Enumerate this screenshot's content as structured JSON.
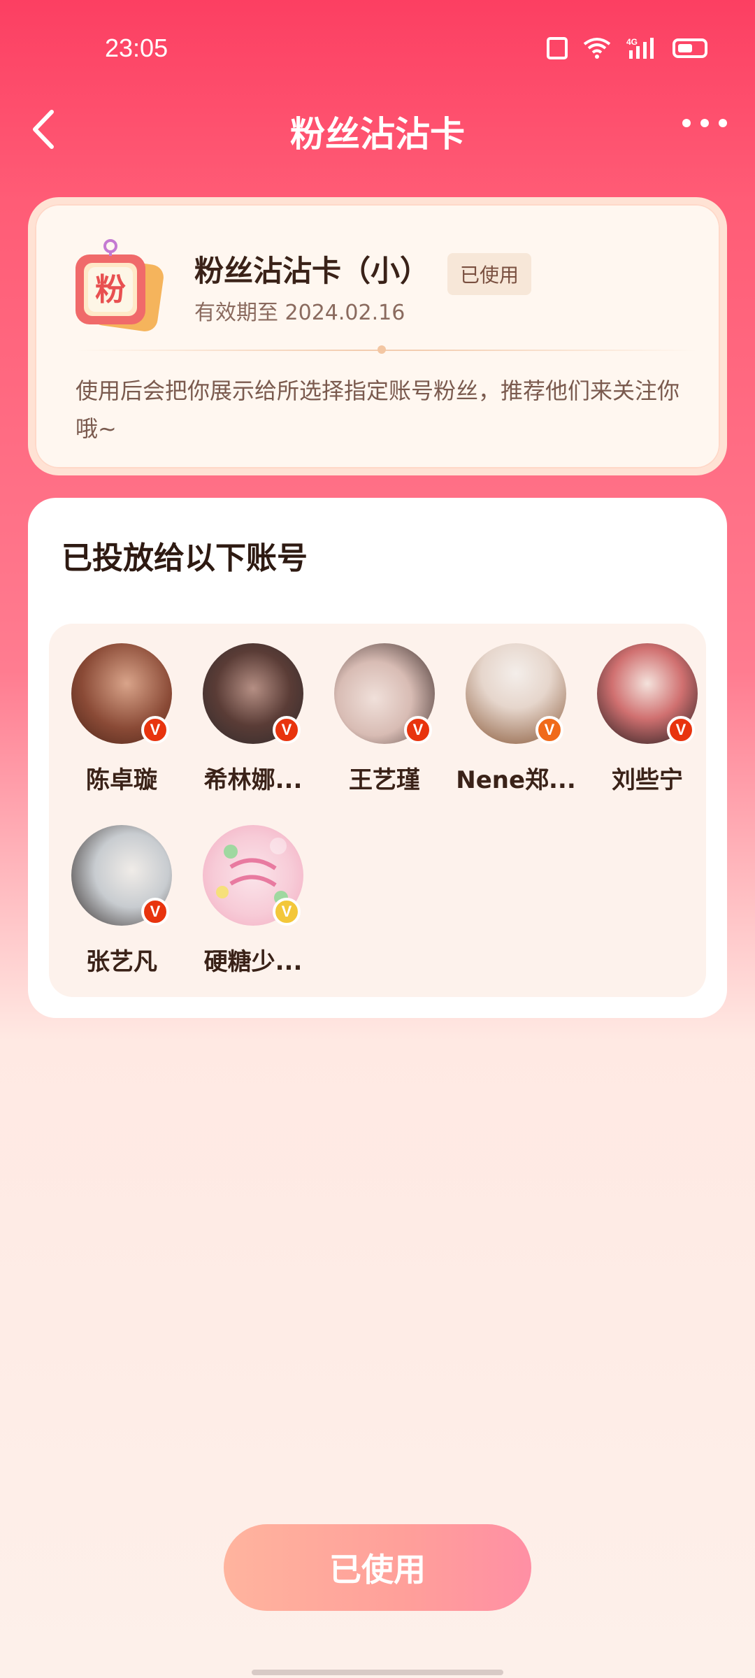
{
  "status_bar": {
    "time": "23:05",
    "network": "4G",
    "icons": [
      "vibrate-icon",
      "wifi-icon",
      "signal-icon",
      "battery-icon"
    ]
  },
  "header": {
    "title": "粉丝沾沾卡",
    "back_icon": "chevron-left-icon",
    "more_icon": "more-horizontal-icon"
  },
  "card": {
    "icon_text": "粉",
    "name": "粉丝沾沾卡（小）",
    "badge": "已使用",
    "expiry": "有效期至 2024.02.16",
    "description": "使用后会把你展示给所选择指定账号粉丝，推荐他们来关注你哦~"
  },
  "accounts": {
    "title": "已投放给以下账号",
    "items": [
      {
        "name": "陈卓璇",
        "badge": "V",
        "badge_color": "#e8340e",
        "avatar_colors": [
          "#6b3a2a",
          "#d9a48a"
        ]
      },
      {
        "name": "希林娜...",
        "badge": "V",
        "badge_color": "#e8340e",
        "avatar_colors": [
          "#2e2a2c",
          "#b58f84"
        ]
      },
      {
        "name": "王艺瑾",
        "badge": "V",
        "badge_color": "#e8340e",
        "avatar_colors": [
          "#e8d6d2",
          "#3a2a28"
        ]
      },
      {
        "name": "Nene郑...",
        "badge": "V",
        "badge_color": "#f06a1a",
        "avatar_colors": [
          "#efe7e2",
          "#8a5a3a"
        ]
      },
      {
        "name": "刘些宁",
        "badge": "V",
        "badge_color": "#e8340e",
        "avatar_colors": [
          "#b02a2a",
          "#f4e2dc"
        ]
      },
      {
        "name": "张艺凡",
        "badge": "V",
        "badge_color": "#e8340e",
        "avatar_colors": [
          "#dfe6ea",
          "#3b3230"
        ]
      },
      {
        "name": "硬糖少...",
        "badge": "V",
        "badge_color": "#f3c73a",
        "avatar_colors": [
          "#f7d6df",
          "#f2a9bf"
        ]
      }
    ]
  },
  "bottom_button": {
    "label": "已使用"
  },
  "colors": {
    "header_red": "#fc3f62",
    "button_start": "#ffb49e",
    "button_end": "#ff8fa4",
    "card_bg": "#fff7f0"
  }
}
